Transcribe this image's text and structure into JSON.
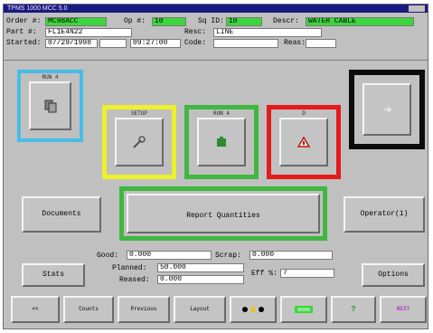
{
  "window": {
    "title": "TPMS 1000 MCC 5.0"
  },
  "header": {
    "order_label": "Order #:",
    "order_value": "MC98ACC",
    "op_label": "Op #:",
    "op_value": "10",
    "seq_label": "Sq ID:",
    "seq_value": "10",
    "descr_label": "Descr:",
    "descr_value": "WATER CABLE",
    "part_label": "Part #:",
    "part_value": "FL1E4N22",
    "resc_label": "Resc:",
    "resc_value": "LINE",
    "started_label": "Started:",
    "started_value": "07/29/1998",
    "time_value": "09:27:00",
    "code_label": "Code:",
    "reas_label": "Reas:"
  },
  "icon_frames": [
    {
      "name": "tool-panel",
      "caption": "RUN 4",
      "border_color": "#46bde6",
      "icon": "copy-icon"
    },
    {
      "name": "setup-panel",
      "caption": "SETUP",
      "border_color": "#eef02a",
      "icon": "wrench-icon"
    },
    {
      "name": "run-panel",
      "caption": "RUN 4",
      "border_color": "#3fb83f",
      "icon": "run-icon"
    },
    {
      "name": "down-panel",
      "caption": "D",
      "border_color": "#e51a1a",
      "icon": "warning-icon"
    },
    {
      "name": "idle-panel",
      "caption": "",
      "border_color": "#0c0c0c",
      "icon": "arrow-icon"
    }
  ],
  "buttons": {
    "documents": "Documents",
    "report_quantities": "Report Quantities",
    "operator": "Operator(1)",
    "stats": "Stats",
    "options": "Options"
  },
  "quantities": {
    "good_label": "Good:",
    "good_value": "0.000",
    "scrap_label": "Scrap:",
    "scrap_value": "0.000",
    "planned_label": "Planned:",
    "planned_value": "50.000",
    "reased_label": "Reased:",
    "reased_value": "0.000",
    "eff_label": "Eff %:",
    "eff_value": "7"
  },
  "toolbar": [
    "<<",
    "Counts",
    "Previous",
    "Layout",
    "",
    "",
    "",
    "NEXT"
  ],
  "colors": {
    "green": "#3cd63c",
    "magenta": "#b33fc1"
  }
}
